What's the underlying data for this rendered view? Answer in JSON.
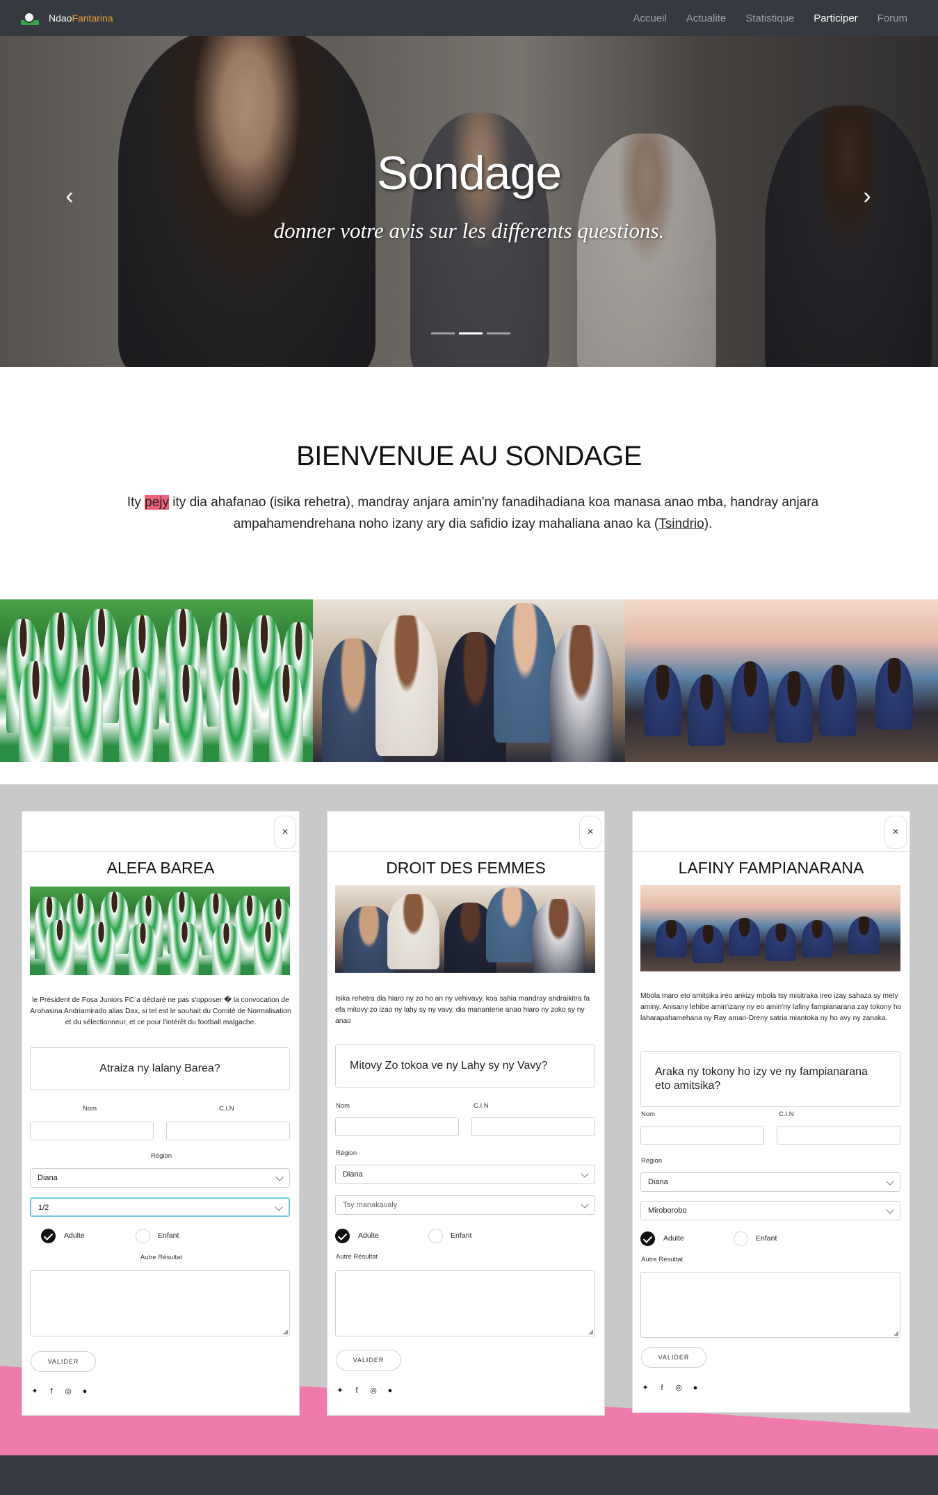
{
  "brand": {
    "part1": "Ndao",
    "part2": "Fantarina"
  },
  "nav": [
    {
      "label": "Accueil"
    },
    {
      "label": "Actualite"
    },
    {
      "label": "Statistique"
    },
    {
      "label": "Participer",
      "active": true
    },
    {
      "label": "Forum"
    }
  ],
  "hero": {
    "title": "Sondage",
    "subtitle": "donner votre avis sur les differents questions.",
    "prev_icon": "chevron-left-icon",
    "next_icon": "chevron-right-icon",
    "slide_count": 3,
    "active_slide": 2
  },
  "welcome": {
    "title": "BIENVENUE AU SONDAGE",
    "text_before": "Ity ",
    "highlight": "pejy",
    "text_after": " ity dia ahafanao (isika rehetra), mandray anjara amin'ny fanadihadiana koa manasa anao mba, handray anjara ampahamendrehana noho izany ary dia safidio izay mahaliana anao ka (",
    "link": "Tsindrio",
    "text_end": ")."
  },
  "colors": {
    "navbar": "#343a40",
    "highlight": "#f25f7a",
    "accent_brand": "#f0a030",
    "forms_bg": "#c9c9c9",
    "pink_band": "#f07aac",
    "focus_border": "#75c6dd"
  },
  "cards": [
    {
      "close": "×",
      "title": "ALEFA BAREA",
      "description": "le Président de Fosa Juniors FC a déclaré ne pas s'opposer � la convocation de Arohasina Andriamirado alias Dax, si tel est le souhait du Comité de Normalisation et du sélectionneur, et ce pour l'intérêt du football malgache.",
      "question": "Atraiza ny lalany Barea?",
      "nom_label": "Nom",
      "cin_label": "C.I.N",
      "region_label": "Région",
      "region_value": "Diana",
      "answer_value": "1/2",
      "adulte_label": "Adulte",
      "enfant_label": "Enfant",
      "autre_label": "Autre Résultat",
      "button": "VALIDER"
    },
    {
      "close": "×",
      "title": "DROIT DES FEMMES",
      "description": "Isika rehetra dia hiaro ny zo ho an ny vehivavy, koa sahia mandray andraikitra fa efa mitovy zo izao ny lahy sy ny vavy, dia manantene anao hiaro ny zoko sy ny anao",
      "question": "Mitovy Zo tokoa ve ny Lahy sy ny Vavy?",
      "nom_label": "Nom",
      "cin_label": "C.I.N",
      "region_label": "Région",
      "region_value": "Diana",
      "answer_value": "Tsy manakavaly",
      "adulte_label": "Adulte",
      "enfant_label": "Enfant",
      "autre_label": "Autre Résultat",
      "button": "VALIDER"
    },
    {
      "close": "×",
      "title": "LAFINY FAMPIANARANA",
      "description": "Mbola maro eto amitsika ireo ankizy mbola tsy misitraka ireo izay sahaza sy mety aminy. Anisany lehibe amin'izany ny eo amin'ny lafiny fampianarana zay tokony ho laharapahamehana ny Ray aman-Dreny satria miantoka ny ho avy ny zanaka.",
      "question": "Araka ny tokony ho izy ve ny fampianarana eto amitsika?",
      "nom_label": "Nom",
      "cin_label": "C.I.N",
      "region_label": "Région",
      "region_value": "Diana",
      "answer_value": "Miroborobo",
      "adulte_label": "Adulte",
      "enfant_label": "Enfant",
      "autre_label": "Autre Résultat",
      "button": "VALIDER"
    }
  ],
  "social_icons": [
    "twitter-icon",
    "facebook-icon",
    "instagram-icon",
    "github-icon"
  ]
}
